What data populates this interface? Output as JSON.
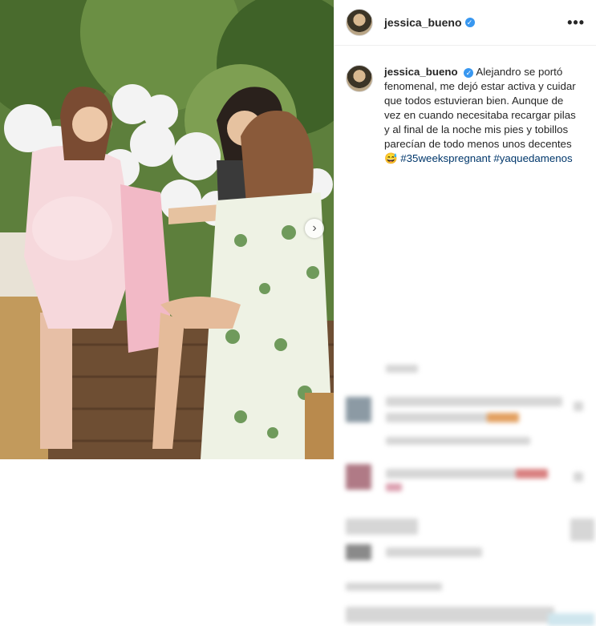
{
  "post": {
    "username": "jessica_bueno",
    "verified": "✓",
    "more": "•••",
    "carousel_next": "›",
    "caption": {
      "username": "jessica_bueno",
      "text": "Alejandro se portó fenomenal, me dejó estar activa y cuidar que todos estuvieran bien. Aunque de vez en cuando necesitaba recargar pilas y al final de la noche mis pies y tobillos parecían de todo menos unos decentes 😅",
      "hashtags": [
        "#35weekspregnant",
        "#yaquedamenos"
      ]
    }
  },
  "colors": {
    "link": "#00376b",
    "verified": "#3897f0"
  }
}
